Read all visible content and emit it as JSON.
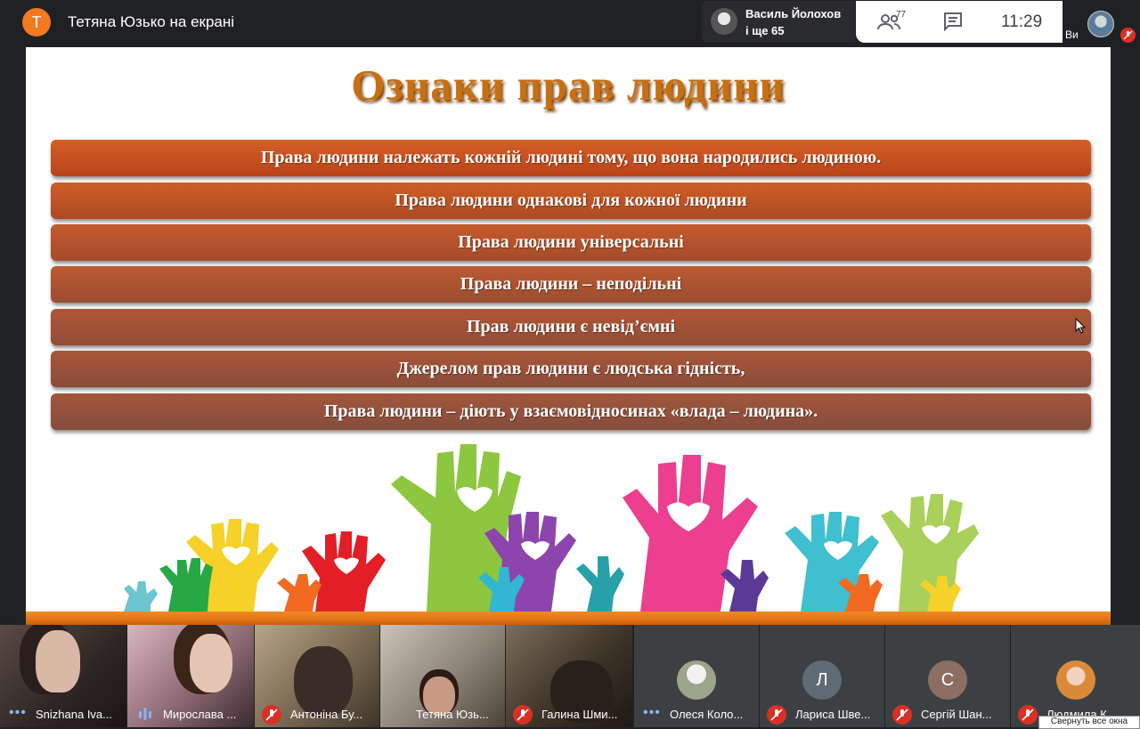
{
  "presenter": {
    "initial": "Т",
    "label": "Тетяна Юзько на екрані"
  },
  "speaker": {
    "name": "Василь Йолохов",
    "more": "і ще 65"
  },
  "toolbar": {
    "participants_count": "77",
    "time": "11:29",
    "self_label": "Ви"
  },
  "slide": {
    "title": "Ознаки прав людини",
    "items": [
      "Права людини належать кожній людині тому, що вона народились людиною.",
      "Права людини однакові для кожної людини",
      "Права людини універсальні",
      "Права людини – неподільні",
      "Прав людини є невід’ємні",
      "Джерелом прав людини є людська гідність,",
      "Права людини – діють у взаємовідносинах «влада – людина»."
    ],
    "colors": {
      "bar_top": "#c9541e",
      "bar_bottom": "#8a4a36",
      "title": "#c76f13"
    }
  },
  "participants": [
    {
      "name": "Snizhana Iva...",
      "status": "speaking-dots"
    },
    {
      "name": "Мирослава ...",
      "status": "speaking-bars"
    },
    {
      "name": "Антоніна Бу...",
      "status": "muted"
    },
    {
      "name": "Тетяна Юзь...",
      "status": "none"
    },
    {
      "name": "Галина Шми...",
      "status": "muted"
    },
    {
      "name": "Олеся Коло...",
      "status": "speaking-dots",
      "avatar": "photo"
    },
    {
      "name": "Лариса Шве...",
      "status": "muted",
      "avatar": "Л"
    },
    {
      "name": "Сергій Шан...",
      "status": "muted",
      "avatar": "С"
    },
    {
      "name": "Людмила К...",
      "status": "muted",
      "avatar": "photo"
    }
  ],
  "tooltip": "Свернуть все окна"
}
